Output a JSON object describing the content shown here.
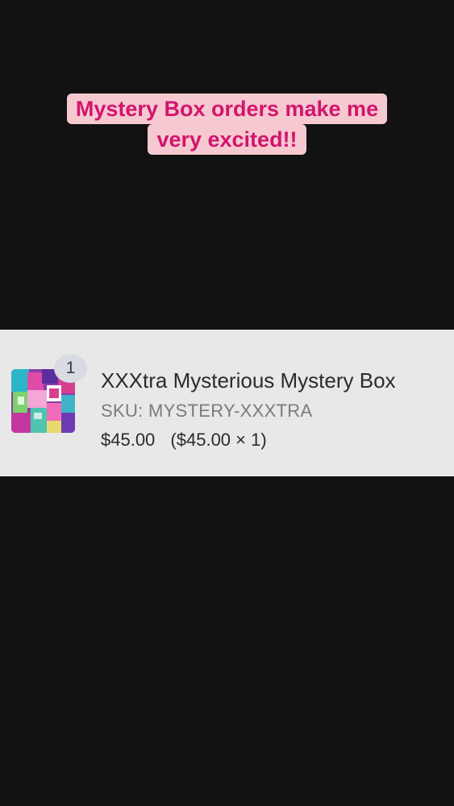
{
  "caption": {
    "line1": "Mystery Box orders make me",
    "line2": "very excited!!",
    "text_color": "#d4146d",
    "background_color": "#f6c9d0"
  },
  "order_item": {
    "quantity_badge": "1",
    "title": "XXXtra Mysterious Mystery Box",
    "sku": "SKU: MYSTERY-XXXTRA",
    "price": "$45.00",
    "unit_breakdown": "($45.00 × 1)",
    "thumbnail_icon": "mystery-box-product-image"
  },
  "colors": {
    "page_background": "#121212",
    "card_background": "#e8e8e8"
  }
}
